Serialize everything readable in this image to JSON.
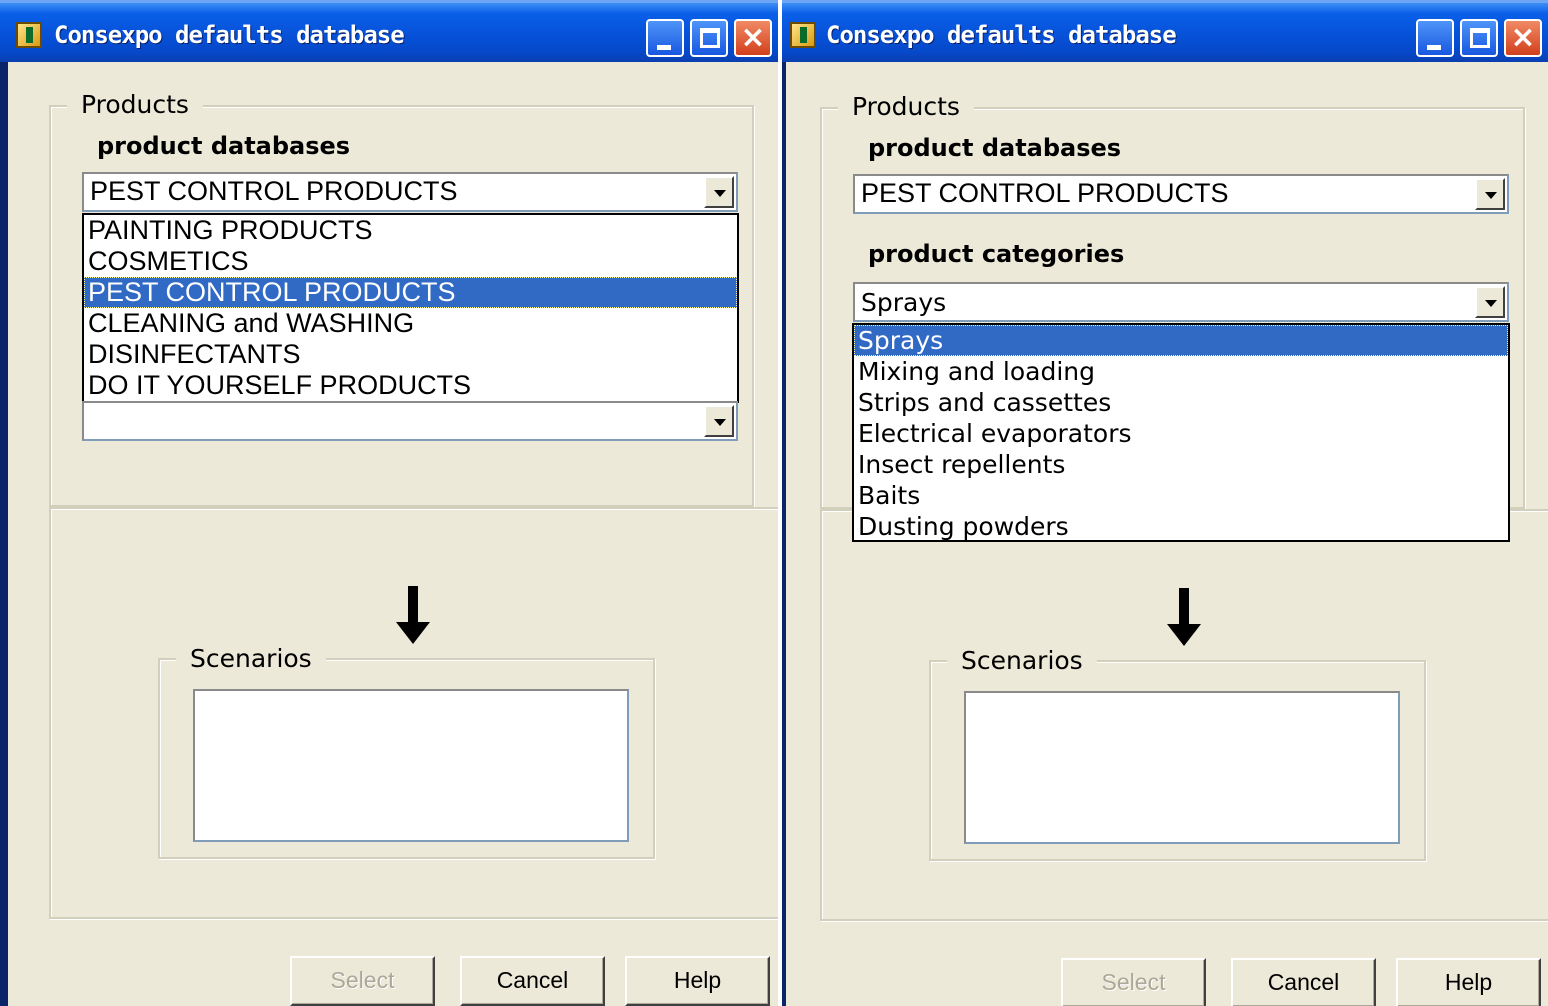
{
  "left_window": {
    "title": "Consexpo defaults database",
    "products_group_label": "Products",
    "product_databases_label": "product databases",
    "product_databases_value": "PEST CONTROL PRODUCTS",
    "product_databases_options": [
      "PAINTING PRODUCTS",
      "COSMETICS",
      "PEST CONTROL PRODUCTS",
      "CLEANING and WASHING",
      "DISINFECTANTS",
      "DO IT YOURSELF PRODUCTS"
    ],
    "product_databases_selected_index": 2,
    "product_categories_value": "",
    "scenarios_group_label": "Scenarios",
    "buttons": {
      "select": "Select",
      "cancel": "Cancel",
      "help": "Help"
    }
  },
  "right_window": {
    "title": "Consexpo defaults database",
    "products_group_label": "Products",
    "product_databases_label": "product databases",
    "product_databases_value": "PEST CONTROL PRODUCTS",
    "product_categories_label": "product categories",
    "product_categories_value": "Sprays",
    "product_categories_options": [
      "Sprays",
      "Mixing and loading",
      "Strips and cassettes",
      "Electrical evaporators",
      "Insect repellents",
      "Baits",
      "Dusting powders"
    ],
    "product_categories_selected_index": 0,
    "scenarios_group_label": "Scenarios",
    "buttons": {
      "select": "Select",
      "cancel": "Cancel",
      "help": "Help"
    }
  },
  "colors": {
    "titlebar": "#0651d8",
    "dialog_background": "#ece9d8",
    "selection_highlight": "#316ac5",
    "close_button": "#d2401c"
  }
}
